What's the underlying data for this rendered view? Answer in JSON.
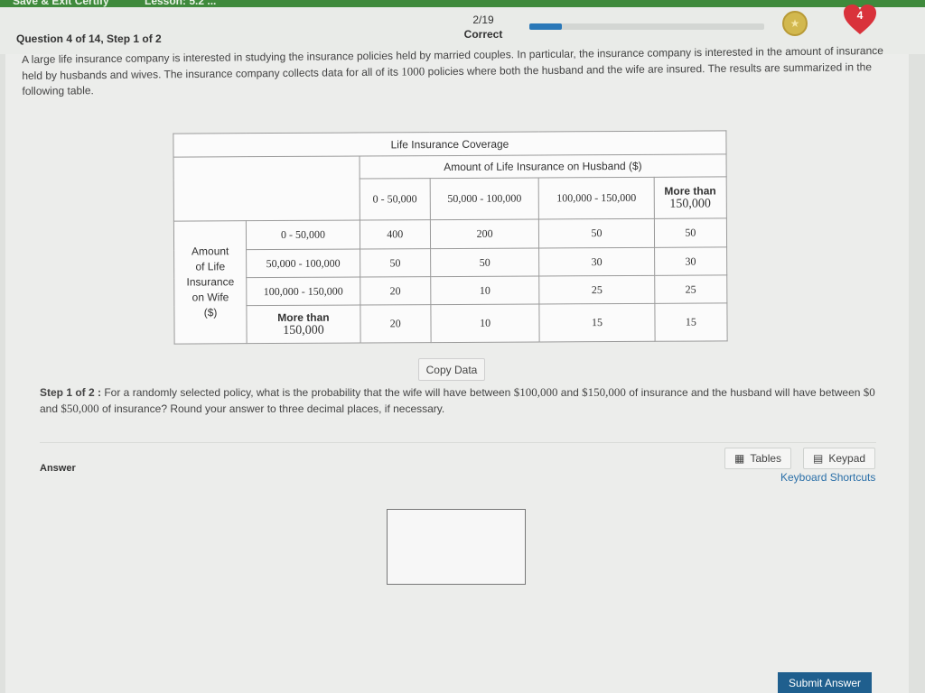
{
  "topbar": {
    "save_label": "Save & Exit Certify",
    "lesson_label": "Lesson: 5.2 ..."
  },
  "header": {
    "question": "Question 4 of 14, Step 1 of 2",
    "progress_count": "2/19",
    "progress_status": "Correct",
    "progress_fraction": 0.14,
    "hearts": "4"
  },
  "intro": {
    "part1": "A large life insurance company is interested in studying the insurance policies held by married couples. In particular, the insurance company is interested in the amount of insurance held by husbands and wives. The insurance company collects data for all of its ",
    "count": "1000",
    "part2": " policies where both the husband and the wife are insured. The results are summarized in the following table."
  },
  "table": {
    "title": "Life Insurance Coverage",
    "husband_header": "Amount of Life Insurance on Husband ($)",
    "col_headers": [
      "0 - 50,000",
      "50,000 - 100,000",
      "100,000 - 150,000"
    ],
    "col_last_top": "More than",
    "col_last_bottom": "150,000",
    "wife_header": [
      "Amount",
      "of Life",
      "Insurance",
      "on Wife",
      "($)"
    ],
    "row_labels": [
      "0 - 50,000",
      "50,000 - 100,000",
      "100,000 - 150,000"
    ],
    "row_last_top": "More than",
    "row_last_bottom": "150,000",
    "rows": [
      [
        "400",
        "200",
        "50",
        "50"
      ],
      [
        "50",
        "50",
        "30",
        "30"
      ],
      [
        "20",
        "10",
        "25",
        "25"
      ],
      [
        "20",
        "10",
        "15",
        "15"
      ]
    ]
  },
  "copy_label": "Copy Data",
  "step": {
    "label": "Step 1 of 2 :",
    "text1": " For a randomly selected policy, what is the probability that the wife will have between ",
    "v1": "$100,000",
    "and1": " and ",
    "v2": "$150,000",
    "text2": " of insurance and the husband will have between ",
    "v3": "$0",
    "and2": " and ",
    "v4": "$50,000",
    "text3": " of insurance? Round your answer to three decimal places, if necessary."
  },
  "answer_label": "Answer",
  "tools": {
    "tables": "Tables",
    "keypad": "Keypad",
    "shortcuts": "Keyboard Shortcuts"
  },
  "submit_label": "Submit Answer"
}
